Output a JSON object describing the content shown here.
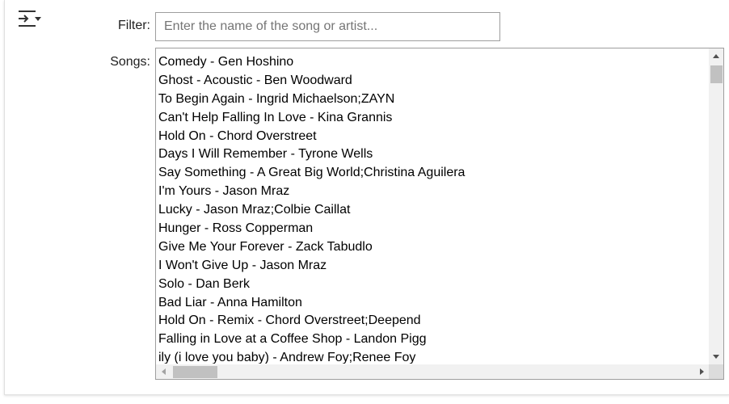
{
  "filter": {
    "label": "Filter:",
    "placeholder": "Enter the name of the song or artist...",
    "value": ""
  },
  "songs": {
    "label": "Songs:",
    "items": [
      "Comedy - Gen Hoshino",
      "Ghost - Acoustic - Ben Woodward",
      "To Begin Again - Ingrid Michaelson;ZAYN",
      "Can't Help Falling In Love - Kina Grannis",
      "Hold On - Chord Overstreet",
      "Days I Will Remember - Tyrone Wells",
      "Say Something - A Great Big World;Christina Aguilera",
      "I'm Yours - Jason Mraz",
      "Lucky - Jason Mraz;Colbie Caillat",
      "Hunger - Ross Copperman",
      "Give Me Your Forever - Zack Tabudlo",
      "I Won't Give Up - Jason Mraz",
      "Solo - Dan Berk",
      "Bad Liar - Anna Hamilton",
      "Hold On - Remix - Chord Overstreet;Deepend",
      "Falling in Love at a Coffee Shop - Landon Pigg",
      "ily (i love you baby) - Andrew Foy;Renee Foy"
    ]
  },
  "icons": {
    "toggle": "collapse-toggle-icon"
  }
}
